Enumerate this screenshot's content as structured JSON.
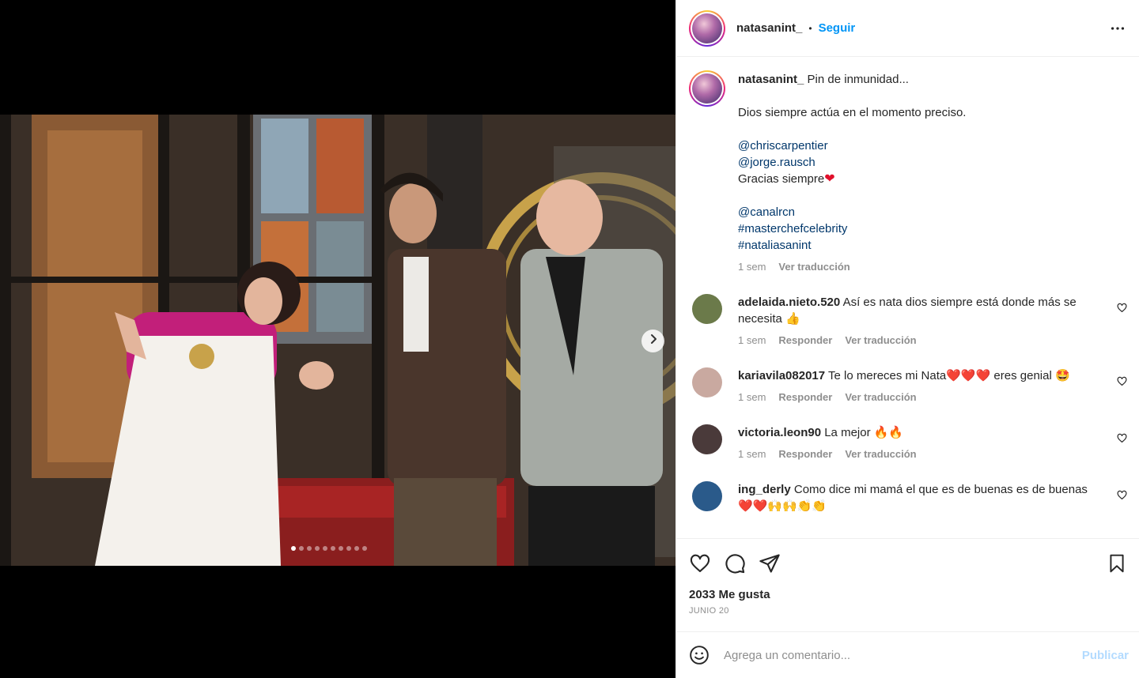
{
  "post": {
    "username": "natasanint_",
    "separator": "•",
    "follow_label": "Seguir",
    "more_icon": "more-horizontal-icon"
  },
  "media": {
    "carousel_total": 10,
    "carousel_index": 1,
    "next_icon": "chevron-right-icon"
  },
  "caption": {
    "username": "natasanint_",
    "line1": "Pin de inmunidad...",
    "line2": "Dios siempre actúa en el momento preciso.",
    "mention1": "@chriscarpentier",
    "mention2": "@jorge.rausch",
    "thanks": "Gracias siempre",
    "thanks_emoji": "❤",
    "mention3": "@canalrcn",
    "hashtag1": "#masterchefcelebrity",
    "hashtag2": "#nataliasanint",
    "time": "1 sem",
    "translate": "Ver traducción"
  },
  "comments": [
    {
      "username": "adelaida.nieto.520",
      "text": "Así es nata dios siempre está donde más se necesita 👍",
      "time": "1 sem",
      "reply": "Responder",
      "translate": "Ver traducción",
      "avatar_color": "#6b7a4a"
    },
    {
      "username": "kariavila082017",
      "text": "Te lo mereces mi Nata❤️❤️❤️ eres genial 🤩",
      "time": "1 sem",
      "reply": "Responder",
      "translate": "Ver traducción",
      "avatar_color": "#c9a9a0"
    },
    {
      "username": "victoria.leon90",
      "text": "La mejor 🔥🔥",
      "time": "1 sem",
      "reply": "Responder",
      "translate": "Ver traducción",
      "avatar_color": "#4a3a3a"
    },
    {
      "username": "ing_derly",
      "text": "Como dice mi mamá el que es de buenas es de buenas ❤️❤️🙌🙌👏👏",
      "time": "",
      "reply": "",
      "translate": "",
      "avatar_color": "#2a5a8a"
    }
  ],
  "actions": {
    "likes": "2033 Me gusta",
    "date": "JUNIO 20"
  },
  "add_comment": {
    "placeholder": "Agrega un comentario...",
    "publish": "Publicar"
  },
  "colors": {
    "link": "#00376b",
    "follow": "#0095f6",
    "muted": "#8e8e8e",
    "publish_disabled": "#b3dbff"
  }
}
